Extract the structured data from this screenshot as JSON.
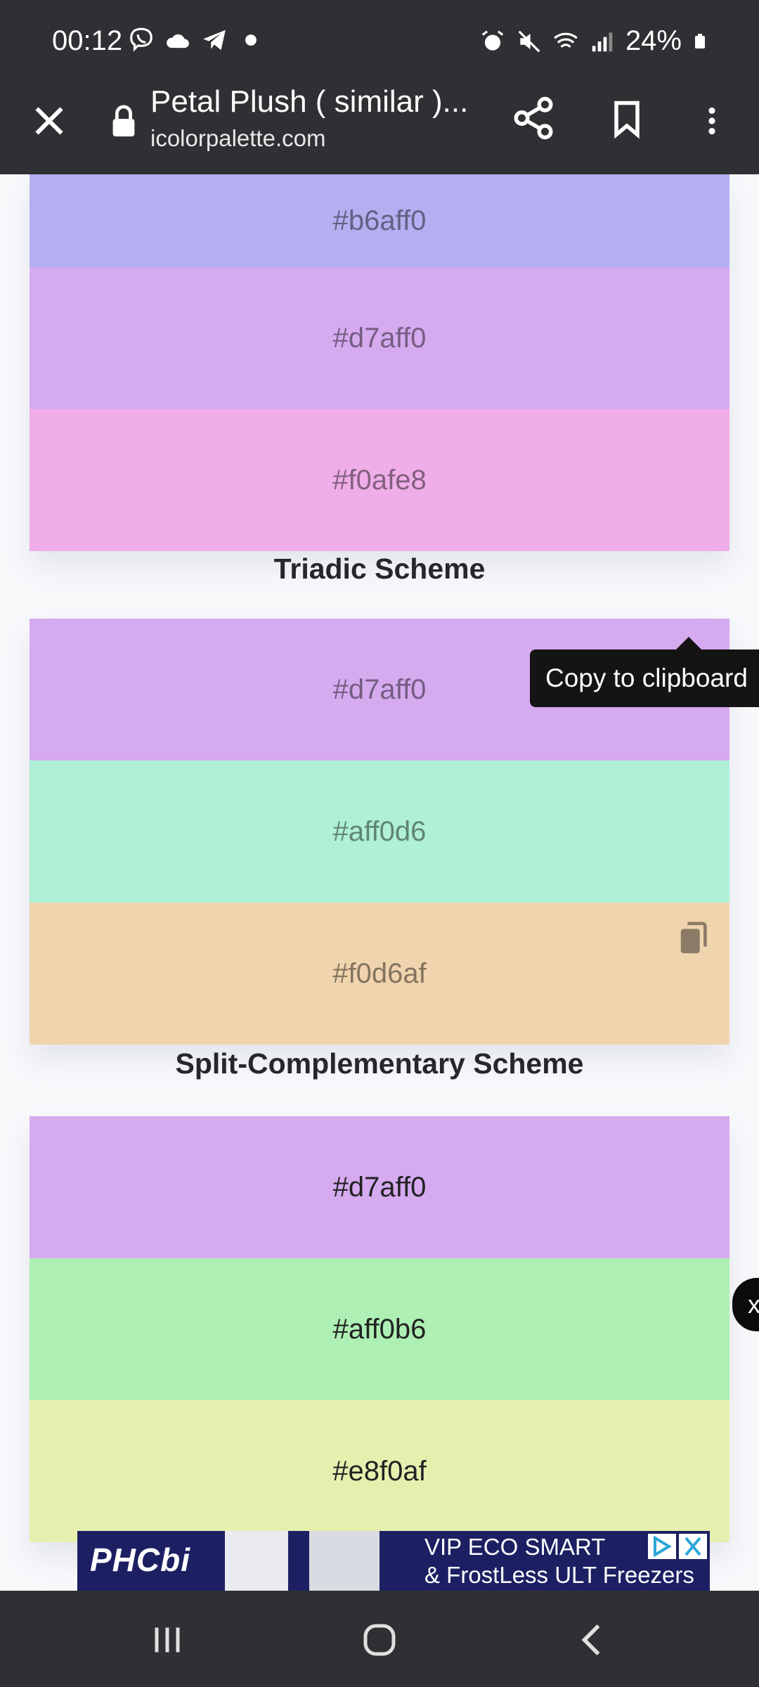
{
  "status_bar": {
    "time": "00:12",
    "battery": "24%",
    "left_icons": [
      "viber-icon",
      "cloud-icon",
      "telegram-icon",
      "dot-icon"
    ],
    "right_icons": [
      "alarm-icon",
      "mute-icon",
      "wifi-call-icon",
      "signal-icon",
      "battery-icon"
    ]
  },
  "browser": {
    "title": "Petal Plush ( similar )...",
    "url": "icolorpalette.com"
  },
  "palette": {
    "group1": [
      {
        "hex": "#b6aff0",
        "color": "#b4aff0"
      },
      {
        "hex": "#d7aff0",
        "color": "#d5aaef"
      },
      {
        "hex": "#f0afe8",
        "color": "#efaee7"
      }
    ],
    "triadic_title": "Triadic Scheme",
    "triadic": [
      {
        "hex": "#d7aff0",
        "color": "#d5aaef"
      },
      {
        "hex": "#aff0d6",
        "color": "#aff0d6"
      },
      {
        "hex": "#f0d6af",
        "color": "#efd4ae"
      }
    ],
    "split_title": "Split-Complementary Scheme",
    "split": [
      {
        "hex": "#d7aff0",
        "color": "#d5aaef"
      },
      {
        "hex": "#aff0b6",
        "color": "#aef0b4"
      },
      {
        "hex": "#e8f0af",
        "color": "#e7efae"
      }
    ]
  },
  "tooltip": "Copy to clipboard",
  "side_close": "x",
  "ad": {
    "brand": "PHCbi",
    "line1": "VIP ECO SMART",
    "line2": "& FrostLess ULT Freezers"
  }
}
